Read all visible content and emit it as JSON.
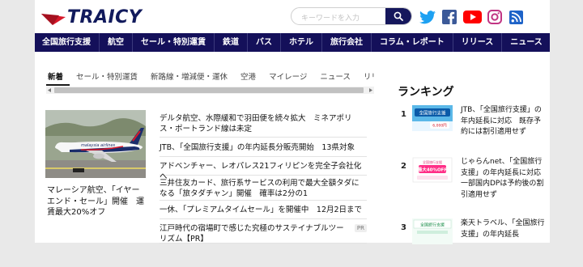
{
  "header": {
    "logo_text": "TRAICY",
    "search_placeholder": "キーワードを入力",
    "brand_color": "#14105a",
    "accent_color": "#d7182a"
  },
  "social": [
    {
      "name": "twitter-icon",
      "color": "#1da1f2"
    },
    {
      "name": "facebook-icon",
      "color": "#3b5998"
    },
    {
      "name": "youtube-icon",
      "color": "#ff0000"
    },
    {
      "name": "instagram-icon",
      "color": "#c13584"
    },
    {
      "name": "rss-icon",
      "color": "#1e63c8"
    }
  ],
  "nav": [
    "全国旅行支援",
    "航空",
    "セール・特別運賃",
    "鉄道",
    "バス",
    "ホテル",
    "旅行会社",
    "コラム・レポート",
    "リリース",
    "ニュース"
  ],
  "tabs": [
    "新着",
    "セール・特別運賃",
    "新路線・増減便・運休",
    "空港",
    "マイレージ",
    "ニュース",
    "リリース"
  ],
  "featured": {
    "title": "マレーシア航空、「イヤーエンド・セール」開催　運賃最大20%オフ",
    "image_text": "malaysia airlines"
  },
  "articles": [
    {
      "title": "デルタ航空、水際緩和で羽田便を続々拡大　ミネアポリス・ポートランド線は未定"
    },
    {
      "title": "JTB、「全国旅行支援」の年内延長分販売開始　13県対象"
    },
    {
      "title": "アドベンチャー、レオパレス21フィリピンを完全子会社化へ"
    },
    {
      "title": "三井住友カード、旅行系サービスの利用で最大全額タダになる「旅タダチャン」開催　確率は2分の1"
    },
    {
      "title": "一休、「プレミアムタイムセール」を開催中　12月2日まで"
    },
    {
      "title": "江戸時代の宿場町で感じた究極のサステイナブルツーリズム【PR】",
      "badge": "PR"
    }
  ],
  "ranking": {
    "heading": "ランキング",
    "items": [
      {
        "rank": "1",
        "title": "JTB、「全国旅行支援」の年内延長に対応　既存予約には割引適用せず",
        "thumb_text": "全国旅行支援",
        "thumb_sub": "6,000円"
      },
      {
        "rank": "2",
        "title": "じゃらんnet、「全国旅行支援」の年内延長に対応　一部国内DPは予約後の割引適用せず",
        "thumb_text": "最大40%OFF",
        "thumb_sub": "全国旅行支援"
      },
      {
        "rank": "3",
        "title": "楽天トラベル、「全国旅行支援」の年内延長",
        "thumb_text": "全国旅行支援",
        "thumb_sub": ""
      }
    ]
  }
}
